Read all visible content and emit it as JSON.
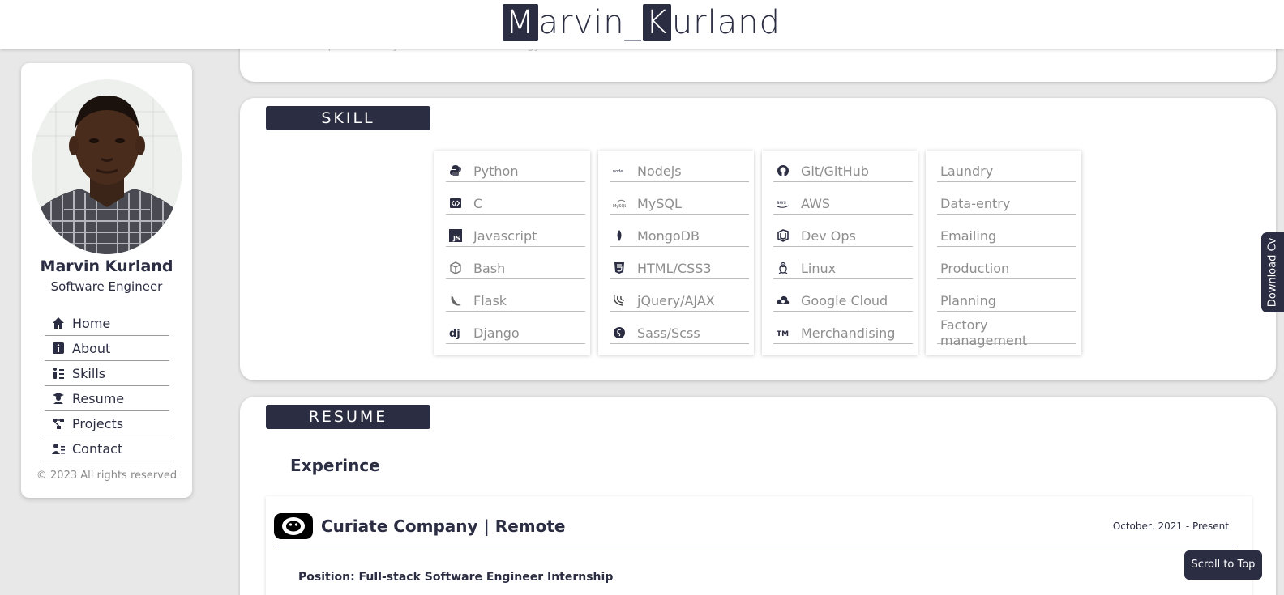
{
  "header": {
    "logo_first_letter": "M",
    "logo_first_rest": "arvin_",
    "logo_second_letter": "K",
    "logo_second_rest": "urland"
  },
  "sidebar": {
    "name": "Marvin Kurland",
    "role": "Software Engineer",
    "nav": [
      {
        "label": "Home",
        "icon": "home-icon"
      },
      {
        "label": "About",
        "icon": "info-icon"
      },
      {
        "label": "Skills",
        "icon": "skills-icon"
      },
      {
        "label": "Resume",
        "icon": "graduate-icon"
      },
      {
        "label": "Projects",
        "icon": "diagram-icon"
      },
      {
        "label": "Contact",
        "icon": "contact-card-icon"
      }
    ],
    "copyright": "© 2023 All rights reserved"
  },
  "about": {
    "faded_text": "… passionately … … … … … technology … … …"
  },
  "skill": {
    "heading": "SKILL",
    "columns": [
      [
        {
          "label": "Python",
          "icon": "python-icon"
        },
        {
          "label": "C",
          "icon": "code-icon"
        },
        {
          "label": "Javascript",
          "icon": "js-icon"
        },
        {
          "label": "Bash",
          "icon": "cube-icon"
        },
        {
          "label": "Flask",
          "icon": "flask-icon"
        },
        {
          "label": "Django",
          "icon": "django-icon"
        }
      ],
      [
        {
          "label": "Nodejs",
          "icon": "nodejs-icon"
        },
        {
          "label": "MySQL",
          "icon": "mysql-icon"
        },
        {
          "label": "MongoDB",
          "icon": "leaf-icon"
        },
        {
          "label": "HTML/CSS3",
          "icon": "html5-icon"
        },
        {
          "label": "jQuery/AJAX",
          "icon": "jquery-icon"
        },
        {
          "label": "Sass/Scss",
          "icon": "sass-icon"
        }
      ],
      [
        {
          "label": "Git/GitHub",
          "icon": "github-icon"
        },
        {
          "label": "AWS",
          "icon": "aws-icon"
        },
        {
          "label": "Dev Ops",
          "icon": "devops-icon"
        },
        {
          "label": "Linux",
          "icon": "linux-icon"
        },
        {
          "label": "Google Cloud",
          "icon": "cloud-icon"
        },
        {
          "label": "Merchandising",
          "icon": "trademark-icon"
        }
      ],
      [
        {
          "label": "Laundry",
          "icon": ""
        },
        {
          "label": "Data-entry",
          "icon": ""
        },
        {
          "label": "Emailing",
          "icon": ""
        },
        {
          "label": "Production",
          "icon": ""
        },
        {
          "label": "Planning",
          "icon": ""
        },
        {
          "label": "Factory management",
          "icon": ""
        }
      ]
    ]
  },
  "resume": {
    "heading": "RESUME",
    "experience_title": "Experince",
    "job": {
      "company": "Curiate Company | Remote",
      "date": "October, 2021 - Present",
      "position": "Position: Full-stack Software Engineer Internship"
    }
  },
  "floating": {
    "download_cv": "Download Cv",
    "scroll_top": "Scroll to Top"
  },
  "colors": {
    "primary": "#2b2d42",
    "background": "#e8e8e8",
    "card": "#ffffff",
    "muted_text": "#8e8e8e"
  }
}
